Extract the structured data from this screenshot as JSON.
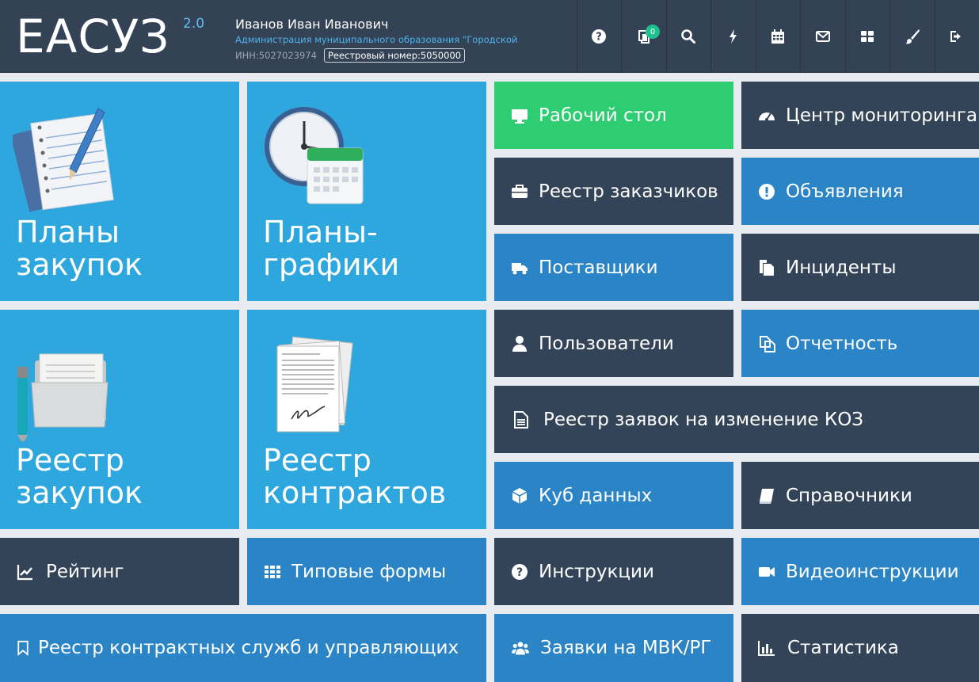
{
  "header": {
    "logo": "ЕАСУЗ",
    "version": "2.0",
    "user_name": "Иванов Иван Иванович",
    "org": "Администрация муниципального образования \"Городской ок...",
    "inn": "ИНН:5027023974",
    "reg_number": "Реестровый номер:5050000",
    "notification_count": "0",
    "toolbar_icons": [
      "help-icon",
      "notifications-icon",
      "search-icon",
      "bolt-icon",
      "calendar-icon",
      "mail-icon",
      "grid-icon",
      "brush-icon",
      "logout-icon"
    ]
  },
  "tiles": {
    "plans": "Планы\nзакупок",
    "schedules": "Планы-\nграфики",
    "purchases": "Реестр\nзакупок",
    "contracts": "Реестр\nконтрактов",
    "desktop": "Рабочий стол",
    "monitoring": "Центр мониторинга",
    "customers": "Реестр заказчиков",
    "announcements": "Объявления",
    "suppliers": "Поставщики",
    "incidents": "Инциденты",
    "users": "Пользователи",
    "reports": "Отчетность",
    "koz": "Реестр заявок на изменение КОЗ",
    "cube": "Куб данных",
    "references": "Справочники",
    "rating": "Рейтинг",
    "forms": "Типовые формы",
    "instructions": "Инструкции",
    "video": "Видеоинструкции",
    "services": "Реестр контрактных служб и управляющих",
    "mvk": "Заявки на МВК/РГ",
    "stats": "Статистика"
  },
  "colors": {
    "header": "#334254",
    "dark_tile": "#344458",
    "blue_tile": "#2a84c5",
    "light_blue_tile": "#2ea6de",
    "green_tile": "#2ecd71"
  }
}
